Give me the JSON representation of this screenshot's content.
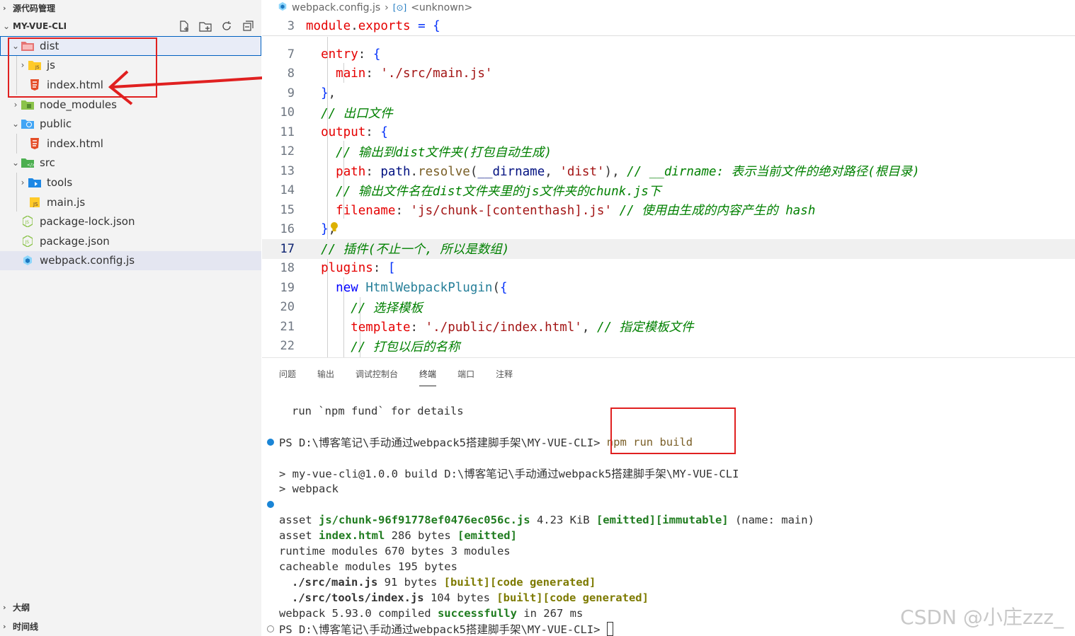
{
  "sidebar": {
    "scm_title": "源代码管理",
    "explorer_title": "MY-VUE-CLI",
    "tree": [
      {
        "label": "dist",
        "type": "folder",
        "expanded": true
      },
      {
        "label": "js",
        "type": "folder",
        "expanded": false
      },
      {
        "label": "index.html",
        "type": "html"
      },
      {
        "label": "node_modules",
        "type": "folder",
        "expanded": false
      },
      {
        "label": "public",
        "type": "folder",
        "expanded": true
      },
      {
        "label": "index.html",
        "type": "html"
      },
      {
        "label": "src",
        "type": "folder",
        "expanded": true
      },
      {
        "label": "tools",
        "type": "folder",
        "expanded": false
      },
      {
        "label": "main.js",
        "type": "js"
      },
      {
        "label": "package-lock.json",
        "type": "json"
      },
      {
        "label": "package.json",
        "type": "json"
      },
      {
        "label": "webpack.config.js",
        "type": "webpack"
      }
    ],
    "outline_title": "大纲",
    "timeline_title": "时间线"
  },
  "editor": {
    "breadcrumb_file": "webpack.config.js",
    "breadcrumb_symbol": "<unknown>",
    "sticky_line_number": "3",
    "sticky_code": "module.exports = {",
    "line_numbers": [
      "7",
      "8",
      "9",
      "10",
      "11",
      "12",
      "13",
      "14",
      "15",
      "16",
      "17",
      "18",
      "19",
      "20",
      "21",
      "22"
    ],
    "current_line": "17"
  },
  "panel": {
    "tabs": [
      "问题",
      "输出",
      "调试控制台",
      "终端",
      "端口",
      "注释"
    ],
    "active_tab": "终端",
    "terminal": {
      "l1": "run `npm fund` for details",
      "prompt1": "PS D:\\博客笔记\\手动通过webpack5搭建脚手架\\MY-VUE-CLI> ",
      "cmd1": "npm run build",
      "l3": "> my-vue-cli@1.0.0 build D:\\博客笔记\\手动通过webpack5搭建脚手架\\MY-VUE-CLI",
      "l4": "> webpack",
      "asset1_pre": "asset ",
      "asset1_name": "js/chunk-96f91778ef0476ec056c.js",
      "asset1_size": " 4.23 KiB ",
      "asset1_tag1": "[emitted]",
      "asset1_tag2": "[immutable]",
      "asset1_post": " (name: main)",
      "asset2_pre": "asset ",
      "asset2_name": "index.html",
      "asset2_size": " 286 bytes ",
      "asset2_tag": "[emitted]",
      "runtime": "runtime modules 670 bytes 3 modules",
      "cacheable": "cacheable modules 195 bytes",
      "mod1_name": "./src/main.js",
      "mod1_size": " 91 bytes ",
      "mod1_tag1": "[built]",
      "mod1_tag2": "[code generated]",
      "mod2_name": "./src/tools/index.js",
      "mod2_size": " 104 bytes ",
      "mod2_tag1": "[built]",
      "mod2_tag2": "[code generated]",
      "compiled_pre": "webpack 5.93.0 compiled ",
      "compiled_word": "successfully",
      "compiled_post": " in 267 ms",
      "prompt2": "PS D:\\博客笔记\\手动通过webpack5搭建脚手架\\MY-VUE-CLI> "
    }
  },
  "watermark": "CSDN @小庄zzz_",
  "colors": {
    "accent_red": "#e02020",
    "selection": "#0060c0"
  }
}
